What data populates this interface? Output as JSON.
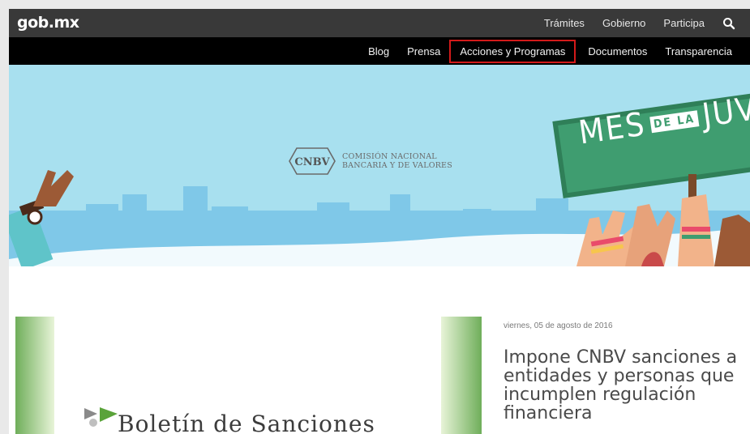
{
  "header": {
    "logo": "gob.mx",
    "top_nav": [
      "Trámites",
      "Gobierno",
      "Participa"
    ],
    "search_icon": "search-icon"
  },
  "subnav": {
    "items": [
      "Blog",
      "Prensa",
      "Acciones y Programas",
      "Documentos",
      "Transparencia"
    ],
    "highlighted": "Acciones y Programas",
    "highlight_color": "#d31a1a"
  },
  "hero": {
    "org_mark": "CNBV",
    "org_name_line1": "COMISIÓN NACIONAL",
    "org_name_line2": "BANCARIA Y DE VALORES",
    "sign_left": "MES",
    "sign_mid": "DE LA",
    "sign_right": "JUVEN",
    "background_color": "#a8e0ef",
    "sign_color": "#3f9d70"
  },
  "article": {
    "image_caption": "Boletín de Sanciones",
    "date": "viernes, 05 de agosto de 2016",
    "title": "Impone CNBV sanciones a entidades y personas que incumplen regulación financiera"
  }
}
